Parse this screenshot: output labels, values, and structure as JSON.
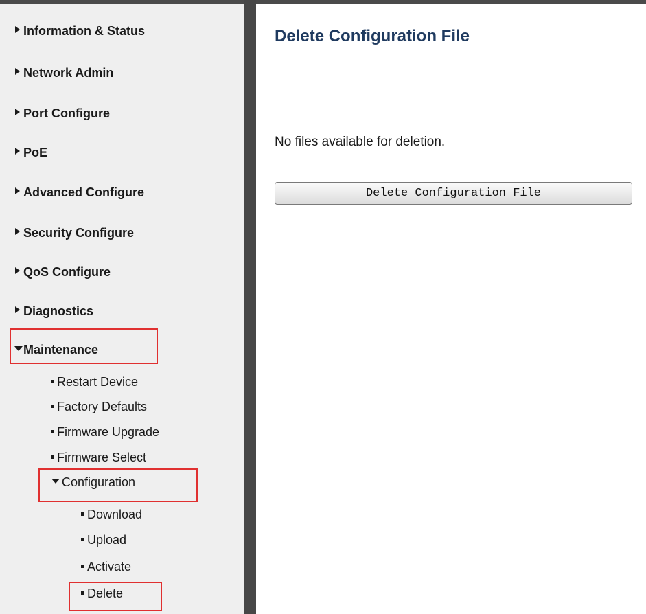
{
  "nav": {
    "items": [
      {
        "label": "Information & Status"
      },
      {
        "label": "Network Admin"
      },
      {
        "label": "Port Configure"
      },
      {
        "label": "PoE"
      },
      {
        "label": "Advanced Configure"
      },
      {
        "label": "Security Configure"
      },
      {
        "label": "QoS Configure"
      },
      {
        "label": "Diagnostics"
      },
      {
        "label": "Maintenance"
      }
    ],
    "maintenance": [
      {
        "label": "Restart Device"
      },
      {
        "label": "Factory Defaults"
      },
      {
        "label": "Firmware Upgrade"
      },
      {
        "label": "Firmware Select"
      },
      {
        "label": "Configuration"
      }
    ],
    "configuration": [
      {
        "label": "Download"
      },
      {
        "label": "Upload"
      },
      {
        "label": "Activate"
      },
      {
        "label": "Delete"
      }
    ]
  },
  "main": {
    "title": "Delete Configuration File",
    "message": "No files available for deletion.",
    "button_label": "Delete Configuration File"
  },
  "colors": {
    "highlight_border": "#e03030",
    "title_color": "#1f3a5f",
    "sidebar_bg": "#efefef",
    "divider": "#474747"
  }
}
